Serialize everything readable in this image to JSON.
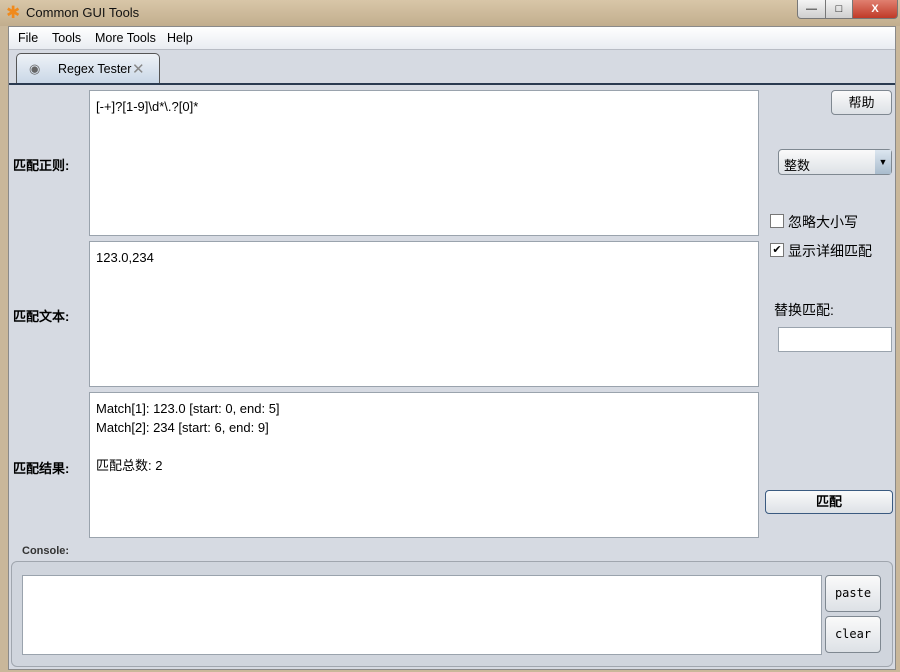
{
  "window": {
    "title": "Common GUI Tools",
    "minimize": "—",
    "maximize": "□",
    "close": "X"
  },
  "menu": [
    "File",
    "Tools",
    "More Tools",
    "Help"
  ],
  "tab": {
    "label": "Regex Tester",
    "close": "✕"
  },
  "labels": {
    "regex": "匹配正则:",
    "text": "匹配文本:",
    "result": "匹配结果:"
  },
  "regex": "[-+]?[1-9]\\d*\\.?[0]*",
  "text": "123.0,234",
  "result": "Match[1]: 123.0 [start: 0, end: 5]\nMatch[2]: 234 [start: 6, end: 9]\n\n匹配总数: 2",
  "side": {
    "help": "帮助",
    "preset": "整数",
    "ignore_case": "忽略大小写",
    "ignore_case_checked": false,
    "detail": "显示详细匹配",
    "detail_checked": true,
    "replace_label": "替换匹配:",
    "replace_value": "",
    "match": "匹配"
  },
  "console": {
    "label": "Console:",
    "value": "",
    "paste": "paste",
    "clear": "clear"
  }
}
